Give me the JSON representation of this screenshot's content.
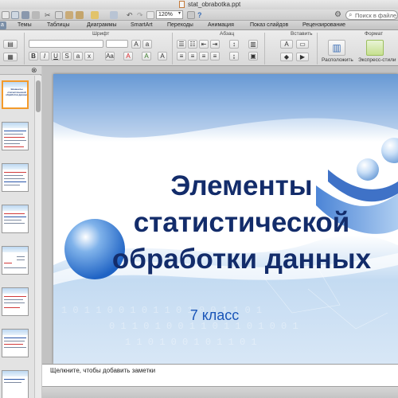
{
  "window": {
    "title": "stat_obrabotka.ppt"
  },
  "toolbar": {
    "zoom_value": "120%",
    "search_placeholder": "Поиск в файле"
  },
  "ribbon": {
    "tabs": [
      "а",
      "Темы",
      "Таблицы",
      "Диаграммы",
      "SmartArt",
      "Переходы",
      "Анимация",
      "Показ слайдов",
      "Рецензирование"
    ],
    "active_tab": "а",
    "groups": {
      "font": "Шрифт",
      "paragraph": "Абзац",
      "insert": "Вставить",
      "format": "Формат"
    },
    "arrange_label": "Расположить",
    "quick_styles_label": "Экспресс-стили"
  },
  "slide_panel": {
    "thumbnails": [
      {
        "number": "1",
        "selected": true,
        "caption": "Элементы статистической обработки данных"
      },
      {
        "number": "2",
        "selected": false,
        "caption": ""
      },
      {
        "number": "3",
        "selected": false,
        "caption": ""
      },
      {
        "number": "4",
        "selected": false,
        "caption": ""
      },
      {
        "number": "5",
        "selected": false,
        "caption": ""
      },
      {
        "number": "6",
        "selected": false,
        "caption": ""
      },
      {
        "number": "7",
        "selected": false,
        "caption": ""
      },
      {
        "number": "8",
        "selected": false,
        "caption": ""
      }
    ]
  },
  "slide": {
    "title_line1": "Элементы",
    "title_line2": "статистической",
    "title_line3": "обработки данных",
    "subtitle": "7 класс"
  },
  "notes": {
    "placeholder": "Щелкните, чтобы добавить заметки"
  },
  "colors": {
    "title_color": "#132c6a",
    "subtitle_color": "#1a55b8",
    "selection_border": "#f39a2b"
  }
}
